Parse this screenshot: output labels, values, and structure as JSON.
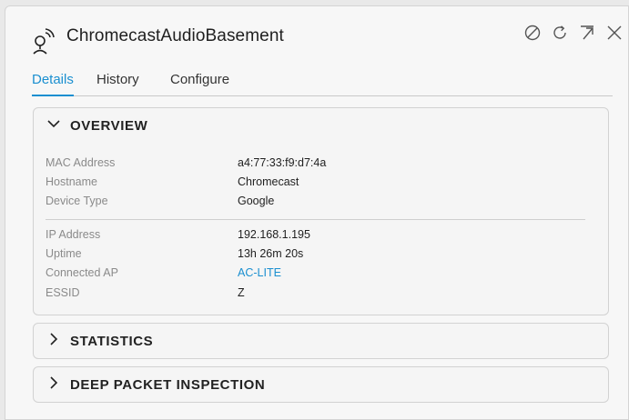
{
  "header": {
    "title": "ChromecastAudioBasement",
    "device_icon": "wireless-client-icon",
    "actions": [
      {
        "icon": "block-icon"
      },
      {
        "icon": "refresh-icon"
      },
      {
        "icon": "popout-icon"
      },
      {
        "icon": "close-icon"
      }
    ]
  },
  "tabs": [
    {
      "label": "Details",
      "active": true
    },
    {
      "label": "History",
      "active": false
    },
    {
      "label": "Configure",
      "active": false
    }
  ],
  "sections": {
    "overview": {
      "title": "OVERVIEW",
      "expanded": true,
      "group1": [
        {
          "label": "MAC Address",
          "value": "a4:77:33:f9:d7:4a"
        },
        {
          "label": "Hostname",
          "value": "Chromecast"
        },
        {
          "label": "Device Type",
          "value": "Google"
        }
      ],
      "group2": [
        {
          "label": "IP Address",
          "value": "192.168.1.195"
        },
        {
          "label": "Uptime",
          "value": "13h 26m 20s"
        },
        {
          "label": "Connected AP",
          "value": "AC-LITE",
          "link": true
        },
        {
          "label": "ESSID",
          "value": "Z"
        }
      ]
    },
    "statistics": {
      "title": "STATISTICS",
      "expanded": false
    },
    "dpi": {
      "title": "DEEP PACKET INSPECTION",
      "expanded": false
    }
  },
  "colors": {
    "accent": "#1a8fd0",
    "label_gray": "#8a8a8a",
    "panel_bg": "#f7f7f7"
  }
}
